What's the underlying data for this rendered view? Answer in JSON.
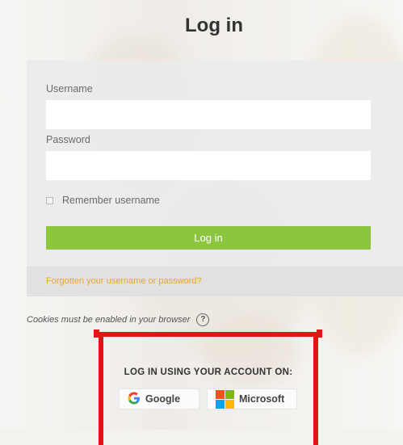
{
  "page": {
    "title": "Log in"
  },
  "form": {
    "username_label": "Username",
    "username_value": "",
    "password_label": "Password",
    "password_value": "",
    "remember_label": "Remember username",
    "login_button": "Log in",
    "forgot_link": "Forgotten your username or password?"
  },
  "cookies": {
    "text": "Cookies must be enabled in your browser",
    "help_icon": "question-circle-icon"
  },
  "sso": {
    "heading": "LOG IN USING YOUR ACCOUNT ON:",
    "google_label": "Google",
    "microsoft_label": "Microsoft"
  },
  "colors": {
    "accent_green": "#8cc63f",
    "link_orange": "#e8a33a",
    "highlight_red": "#e11515",
    "google_blue": "#4285f4",
    "ms_red": "#f25022",
    "ms_green": "#7fba00",
    "ms_blue": "#00a4ef",
    "ms_yellow": "#ffb900"
  }
}
